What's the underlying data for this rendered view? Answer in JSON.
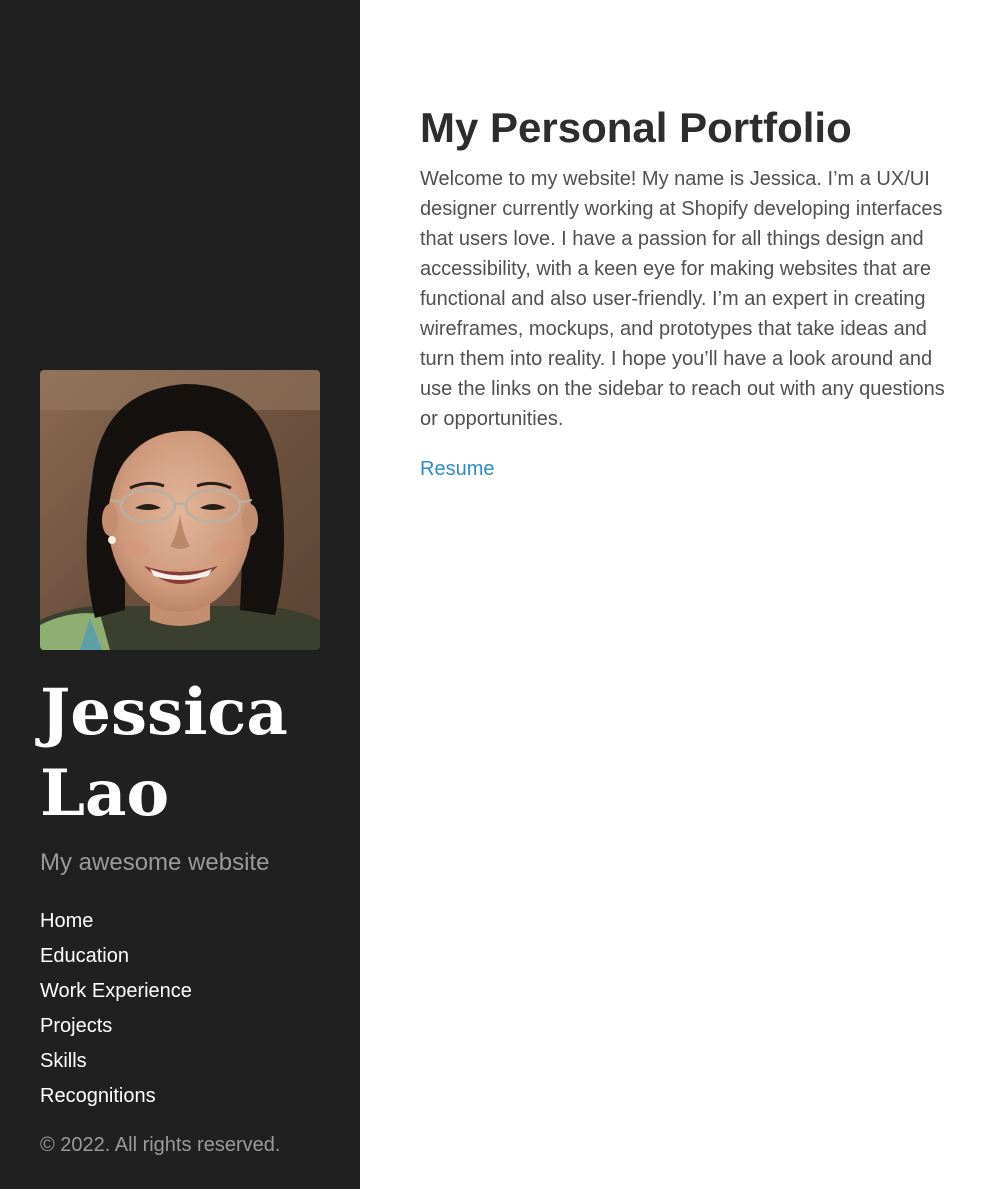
{
  "sidebar": {
    "avatar_alt": "Portrait photo of Jessica Lao",
    "name_line1": "Jessica",
    "name_line2": "Lao",
    "tagline": "My awesome website",
    "nav": [
      {
        "label": "Home"
      },
      {
        "label": "Education"
      },
      {
        "label": "Work Experience"
      },
      {
        "label": "Projects"
      },
      {
        "label": "Skills"
      },
      {
        "label": "Recognitions"
      }
    ],
    "copyright": "© 2022. All rights reserved."
  },
  "main": {
    "title": "My Personal Portfolio",
    "intro": "Welcome to my website! My name is Jessica. I’m a UX/UI designer currently working at Shopify developing interfaces that users love. I have a passion for all things design and accessibility, with a keen eye for making websites that are functional and also user-friendly. I’m an expert in creating wireframes, mockups, and prototypes that take ideas and turn them into reality. I hope you’ll have a look around and use the links on the sidebar to reach out with any questions or opportunities.",
    "resume_label": "Resume"
  },
  "colors": {
    "sidebar_bg": "#202020",
    "link": "#2a8cc9",
    "muted": "#9a9a9a",
    "heading": "#2d2d2d",
    "body_text": "#505050"
  }
}
